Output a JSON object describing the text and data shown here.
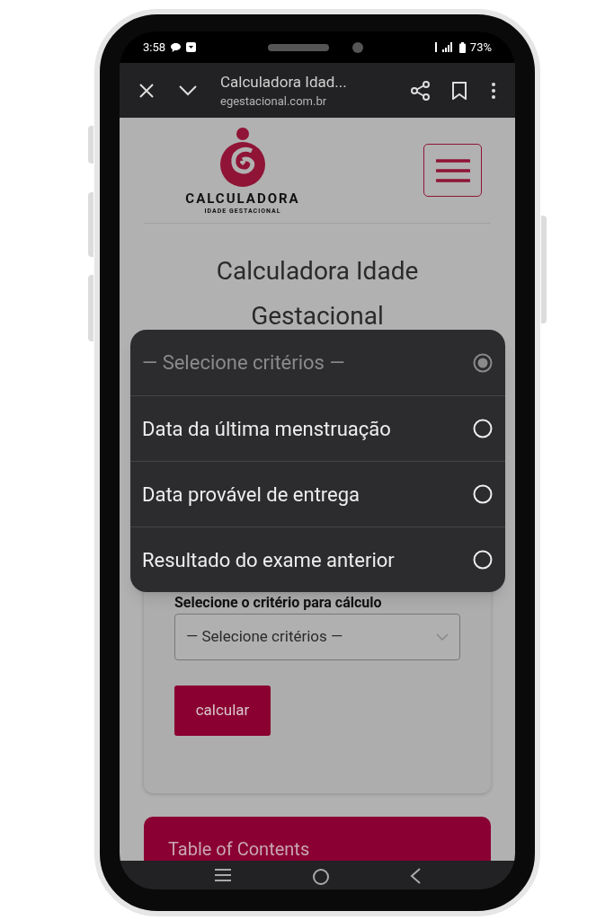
{
  "status_bar": {
    "time": "3:58",
    "battery": "73%"
  },
  "browser_bar": {
    "title": "Calculadora Idad...",
    "url": "egestacional.com.br"
  },
  "logo": {
    "title": "CALCULADORA",
    "subtitle": "IDADE GESTACIONAL"
  },
  "page_title": "Calculadora Idade Gestacional",
  "form": {
    "label": "Selecione o critério para cálculo",
    "select_value": "— Selecione critérios —",
    "button": "calcular"
  },
  "toc": {
    "title": "Table of Contents"
  },
  "dropdown": {
    "options": [
      {
        "label": "— Selecione critérios —",
        "selected": true,
        "disabled": true
      },
      {
        "label": "Data da última menstruação",
        "selected": false,
        "disabled": false
      },
      {
        "label": "Data provável de entrega",
        "selected": false,
        "disabled": false
      },
      {
        "label": "Resultado do exame anterior",
        "selected": false,
        "disabled": false
      }
    ]
  }
}
